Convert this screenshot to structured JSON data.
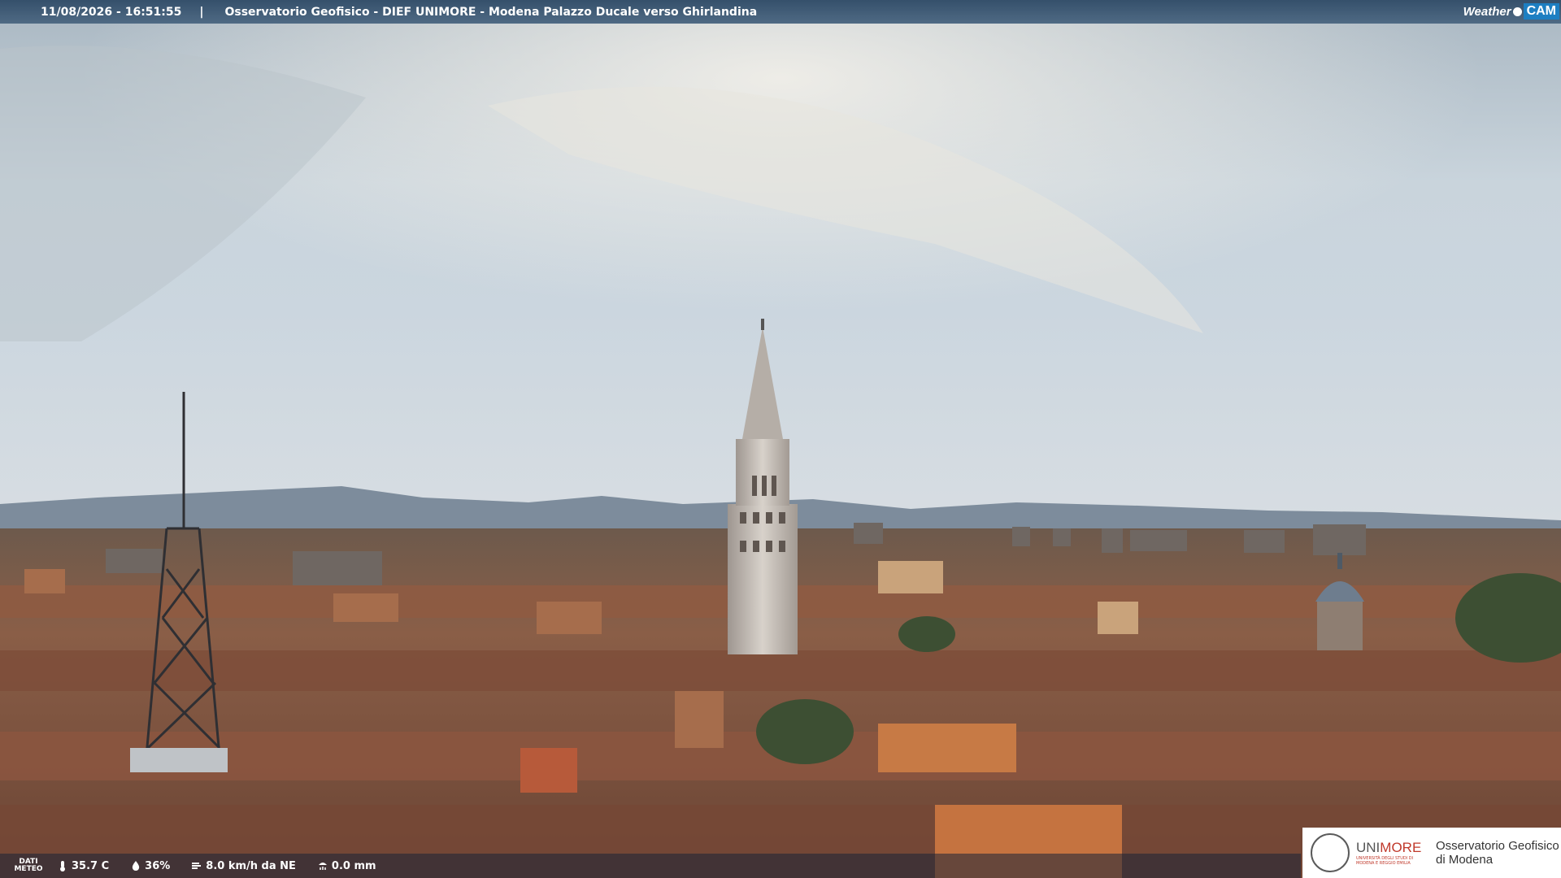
{
  "overlay": {
    "timestamp": "11/08/2026 - 16:51:55",
    "separator": "|",
    "title": "Osservatorio Geofisico - DIEF UNIMORE - Modena Palazzo Ducale verso Ghirlandina"
  },
  "brand": {
    "weather": "Weather",
    "cam": "CAM"
  },
  "meteo": {
    "label_line1": "DATI",
    "label_line2": "METEO",
    "temperature": "35.7 C",
    "humidity": "36%",
    "wind": "8.0 km/h da NE",
    "rain": "0.0 mm"
  },
  "logo": {
    "uni_prefix": "UNI",
    "uni_suffix": "MORE",
    "uni_sub": "UNIVERSITÀ DEGLI STUDI DI MODENA E REGGIO EMILIA",
    "line1": "Osservatorio Geofisico",
    "line2": "di Modena"
  },
  "icons": [
    "thermometer-icon",
    "humidity-drop-icon",
    "wind-icon",
    "rain-gauge-icon",
    "webcam-logo-icon",
    "university-seal-icon"
  ],
  "colors": {
    "bar": "#3e5a76",
    "cam_blue": "#1d7fc2",
    "unimore_red": "#c0392b"
  }
}
